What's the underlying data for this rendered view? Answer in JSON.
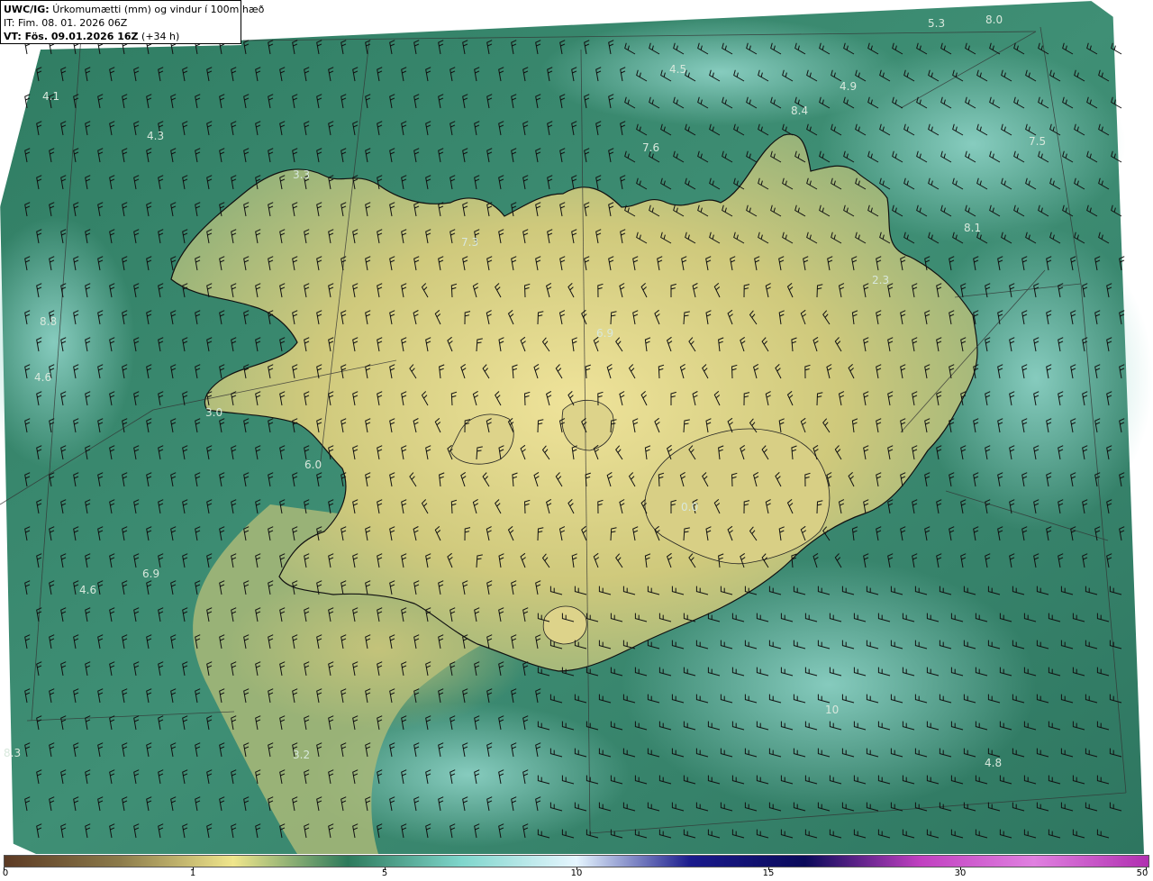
{
  "header": {
    "product": "UWC/IG:",
    "product_desc": "Úrkomumætti (mm) og vindur í 100m hæð",
    "issue_time": "IT: Fim. 08. 01. 2026 06Z",
    "valid_prefix": "VT: Fös. 09.01.2026 16Z",
    "valid_offset": "(+34 h)"
  },
  "colorbar": {
    "ticks": [
      "0",
      "1",
      "5",
      "10",
      "15",
      "30",
      "50"
    ],
    "stops": [
      "#5c3a24",
      "#8b7a4a",
      "#f0e68c",
      "#2d7a5c",
      "#7fd6cc",
      "#e6f6ff",
      "#1a1a8c",
      "#0a0a5a",
      "#c040c0",
      "#e080e0",
      "#b030b0"
    ]
  },
  "map": {
    "colors": {
      "sea_dark": "#2f7d63",
      "sea_mid": "#4a9a80",
      "sea_light": "#7cc2b6",
      "land_low": "#c9c77a",
      "land_high": "#e6df8e",
      "coast": "#111111",
      "grid": "#333333"
    },
    "values": [
      {
        "text": "5.3"
      },
      {
        "text": "8.0"
      },
      {
        "text": "4.5"
      },
      {
        "text": "4.9"
      },
      {
        "text": "4.1"
      },
      {
        "text": "4.3"
      },
      {
        "text": "7.6"
      },
      {
        "text": "3.3"
      },
      {
        "text": "8.4"
      },
      {
        "text": "7.5"
      },
      {
        "text": "7.3"
      },
      {
        "text": "8.8"
      },
      {
        "text": "2.3"
      },
      {
        "text": "8.1"
      },
      {
        "text": "4.6"
      },
      {
        "text": "3.0"
      },
      {
        "text": "6.0"
      },
      {
        "text": "6.9"
      },
      {
        "text": "4.6"
      },
      {
        "text": "3.2"
      },
      {
        "text": "8.3"
      },
      {
        "text": "10"
      },
      {
        "text": "4.8"
      },
      {
        "text": "6.9"
      },
      {
        "text": "0.0"
      }
    ]
  }
}
